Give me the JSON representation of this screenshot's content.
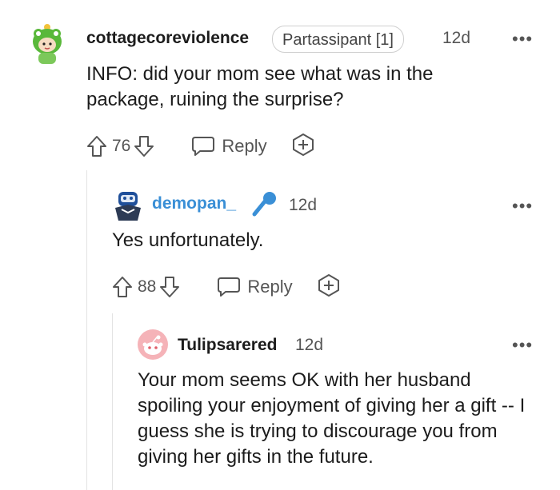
{
  "comments": [
    {
      "username": "cottagecoreviolence",
      "flair": "Partassipant [1]",
      "time": "12d",
      "body": "INFO: did your mom see what was in the package, ruining the surprise?",
      "score": "76",
      "reply_label": "Reply",
      "avatar_icon": "green-frog-snoo-avatar"
    },
    {
      "username": "demopan_",
      "time": "12d",
      "body": "Yes unfortunately.",
      "score": "88",
      "reply_label": "Reply",
      "avatar_icon": "blue-robot-snoo-avatar",
      "badge_icon": "microphone-icon",
      "username_color": "#3a8fd6"
    },
    {
      "username": "Tulipsarered",
      "time": "12d",
      "body": "Your mom seems OK with her husband spoiling your enjoyment of giving her a gift -- I guess she is trying to discourage you from giving her gifts in the future.",
      "avatar_icon": "default-pink-snoo-avatar"
    }
  ],
  "more_label": "•••"
}
